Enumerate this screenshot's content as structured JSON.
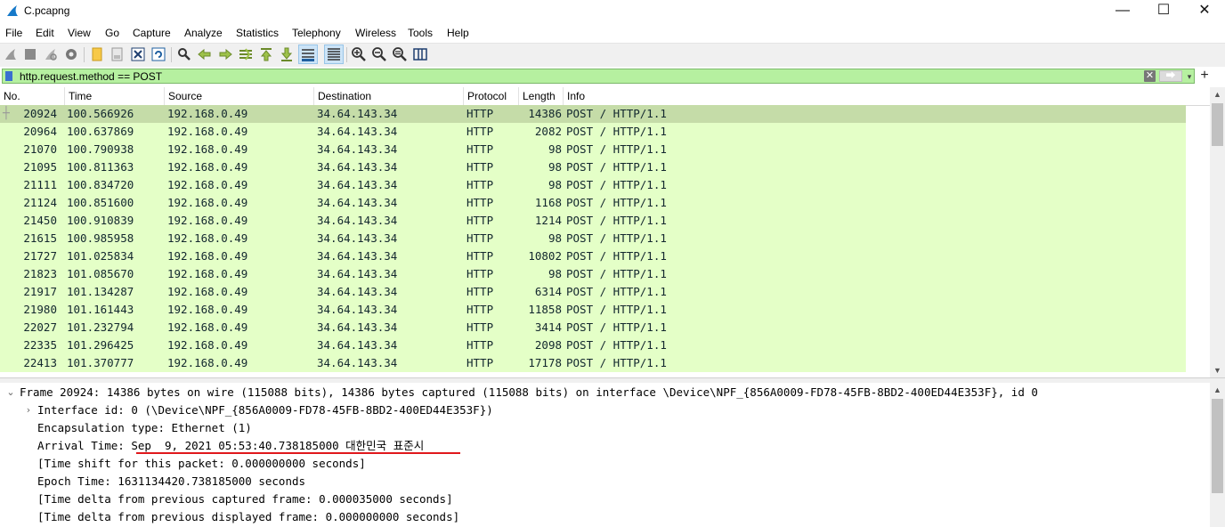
{
  "window": {
    "title": "C.pcapng",
    "controls": {
      "minimize": "—",
      "maximize": "☐",
      "close": "✕"
    },
    "icon": "wireshark-fin-icon"
  },
  "menu": [
    "File",
    "Edit",
    "View",
    "Go",
    "Capture",
    "Analyze",
    "Statistics",
    "Telephony",
    "Wireless",
    "Tools",
    "Help"
  ],
  "toolbar": {
    "icons": [
      "start-capture-icon",
      "stop-capture-icon",
      "restart-capture-icon",
      "capture-options-icon",
      "open-file-icon",
      "save-file-icon",
      "close-file-icon",
      "reload-file-icon",
      "find-packet-icon",
      "go-back-icon",
      "go-forward-icon",
      "go-to-packet-icon",
      "go-first-icon",
      "go-last-icon",
      "autoscroll-icon",
      "colorize-icon",
      "zoom-in-icon",
      "zoom-out-icon",
      "zoom-normal-icon",
      "resize-columns-icon"
    ]
  },
  "filter": {
    "value": "http.request.method == POST",
    "clear": "✕",
    "apply": "⮕",
    "dropdown": "▾",
    "add": "+",
    "color": "#b6f0a0"
  },
  "columns": [
    "No.",
    "Time",
    "Source",
    "Destination",
    "Protocol",
    "Length",
    "Info"
  ],
  "packets": [
    {
      "no": "20924",
      "time": "100.566926",
      "src": "192.168.0.49",
      "dst": "34.64.143.34",
      "proto": "HTTP",
      "len": "14386",
      "info": "POST / HTTP/1.1",
      "selected": true
    },
    {
      "no": "20964",
      "time": "100.637869",
      "src": "192.168.0.49",
      "dst": "34.64.143.34",
      "proto": "HTTP",
      "len": "2082",
      "info": "POST / HTTP/1.1"
    },
    {
      "no": "21070",
      "time": "100.790938",
      "src": "192.168.0.49",
      "dst": "34.64.143.34",
      "proto": "HTTP",
      "len": "98",
      "info": "POST / HTTP/1.1"
    },
    {
      "no": "21095",
      "time": "100.811363",
      "src": "192.168.0.49",
      "dst": "34.64.143.34",
      "proto": "HTTP",
      "len": "98",
      "info": "POST / HTTP/1.1"
    },
    {
      "no": "21111",
      "time": "100.834720",
      "src": "192.168.0.49",
      "dst": "34.64.143.34",
      "proto": "HTTP",
      "len": "98",
      "info": "POST / HTTP/1.1"
    },
    {
      "no": "21124",
      "time": "100.851600",
      "src": "192.168.0.49",
      "dst": "34.64.143.34",
      "proto": "HTTP",
      "len": "1168",
      "info": "POST / HTTP/1.1"
    },
    {
      "no": "21450",
      "time": "100.910839",
      "src": "192.168.0.49",
      "dst": "34.64.143.34",
      "proto": "HTTP",
      "len": "1214",
      "info": "POST / HTTP/1.1"
    },
    {
      "no": "21615",
      "time": "100.985958",
      "src": "192.168.0.49",
      "dst": "34.64.143.34",
      "proto": "HTTP",
      "len": "98",
      "info": "POST / HTTP/1.1"
    },
    {
      "no": "21727",
      "time": "101.025834",
      "src": "192.168.0.49",
      "dst": "34.64.143.34",
      "proto": "HTTP",
      "len": "10802",
      "info": "POST / HTTP/1.1"
    },
    {
      "no": "21823",
      "time": "101.085670",
      "src": "192.168.0.49",
      "dst": "34.64.143.34",
      "proto": "HTTP",
      "len": "98",
      "info": "POST / HTTP/1.1"
    },
    {
      "no": "21917",
      "time": "101.134287",
      "src": "192.168.0.49",
      "dst": "34.64.143.34",
      "proto": "HTTP",
      "len": "6314",
      "info": "POST / HTTP/1.1"
    },
    {
      "no": "21980",
      "time": "101.161443",
      "src": "192.168.0.49",
      "dst": "34.64.143.34",
      "proto": "HTTP",
      "len": "11858",
      "info": "POST / HTTP/1.1"
    },
    {
      "no": "22027",
      "time": "101.232794",
      "src": "192.168.0.49",
      "dst": "34.64.143.34",
      "proto": "HTTP",
      "len": "3414",
      "info": "POST / HTTP/1.1"
    },
    {
      "no": "22335",
      "time": "101.296425",
      "src": "192.168.0.49",
      "dst": "34.64.143.34",
      "proto": "HTTP",
      "len": "2098",
      "info": "POST / HTTP/1.1"
    },
    {
      "no": "22413",
      "time": "101.370777",
      "src": "192.168.0.49",
      "dst": "34.64.143.34",
      "proto": "HTTP",
      "len": "17178",
      "info": "POST / HTTP/1.1"
    }
  ],
  "row_colors": {
    "normal": "#e4ffc7",
    "selected": "#c5dca8"
  },
  "details": [
    {
      "text": "Frame 20924: 14386 bytes on wire (115088 bits), 14386 bytes captured (115088 bits) on interface \\Device\\NPF_{856A0009-FD78-45FB-8BD2-400ED44E353F}, id 0",
      "toggle": "⌄",
      "indent": 0
    },
    {
      "text": "Interface id: 0 (\\Device\\NPF_{856A0009-FD78-45FB-8BD2-400ED44E353F})",
      "toggle": "›",
      "indent": 1
    },
    {
      "text": "Encapsulation type: Ethernet (1)",
      "toggle": "",
      "indent": 1
    },
    {
      "text": "Arrival Time: Sep  9, 2021 05:53:40.738185000 대한민국 표준시",
      "toggle": "",
      "indent": 1
    },
    {
      "text": "[Time shift for this packet: 0.000000000 seconds]",
      "toggle": "",
      "indent": 1
    },
    {
      "text": "Epoch Time: 1631134420.738185000 seconds",
      "toggle": "",
      "indent": 1
    },
    {
      "text": "[Time delta from previous captured frame: 0.000035000 seconds]",
      "toggle": "",
      "indent": 1
    },
    {
      "text": "[Time delta from previous displayed frame: 0.000000000 seconds]",
      "toggle": "",
      "indent": 1
    }
  ],
  "annotation_color": "#e0181c"
}
